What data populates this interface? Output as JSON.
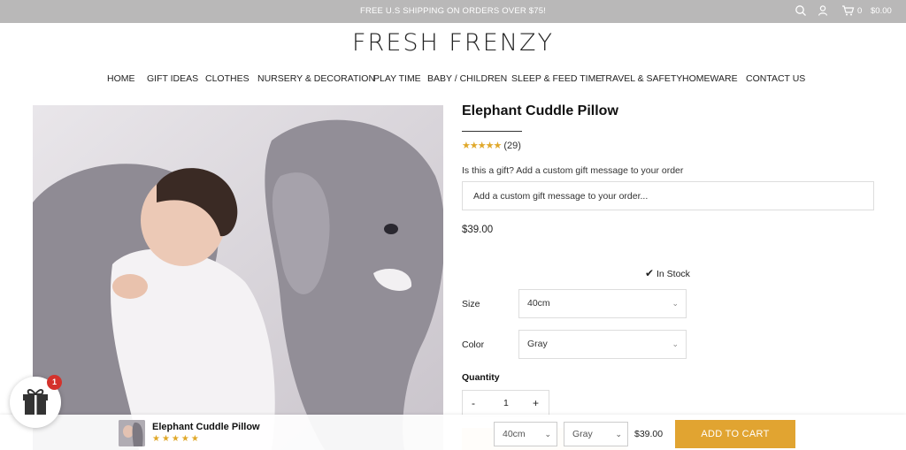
{
  "topbar": {
    "promo": "FREE U.S SHIPPING ON ORDERS OVER $75!",
    "cart_count": "0",
    "cart_total": "$0.00",
    "icons": [
      "search-icon",
      "user-icon",
      "cart-icon"
    ]
  },
  "logo": "FRESH FRENZY",
  "nav": {
    "items": [
      "HOME",
      "GIFT IDEAS",
      "CLOTHES",
      "NURSERY & DECORATION",
      "PLAY TIME",
      "BABY / CHILDREN",
      "SLEEP & FEED TIME",
      "TRAVEL & SAFETY",
      "HOMEWARE",
      "CONTACT US"
    ]
  },
  "product": {
    "title": "Elephant Cuddle Pillow",
    "review_count": "(29)",
    "rating": 5,
    "gift_question": "Is this a gift? Add a custom gift message to your order",
    "gift_placeholder": "Add a custom gift message to your order...",
    "price": "$39.00",
    "stock": "In Stock",
    "size_label": "Size",
    "size_value": "40cm",
    "color_label": "Color",
    "color_value": "Gray",
    "quantity_label": "Quantity",
    "qty_minus": "-",
    "qty_value": "1",
    "qty_plus": "+"
  },
  "sticky_bar": {
    "name": "Elephant Cuddle Pillow",
    "stars": "★★★★★",
    "size": "40cm",
    "color": "Gray",
    "price": "$39.00",
    "add_to_cart": "ADD TO CART"
  },
  "gift_widget": {
    "badge": "1"
  },
  "colors": {
    "topbar": "#b9b8b8",
    "accent": "#e1a431",
    "star": "#e0a82a",
    "badge": "#d4322c"
  }
}
